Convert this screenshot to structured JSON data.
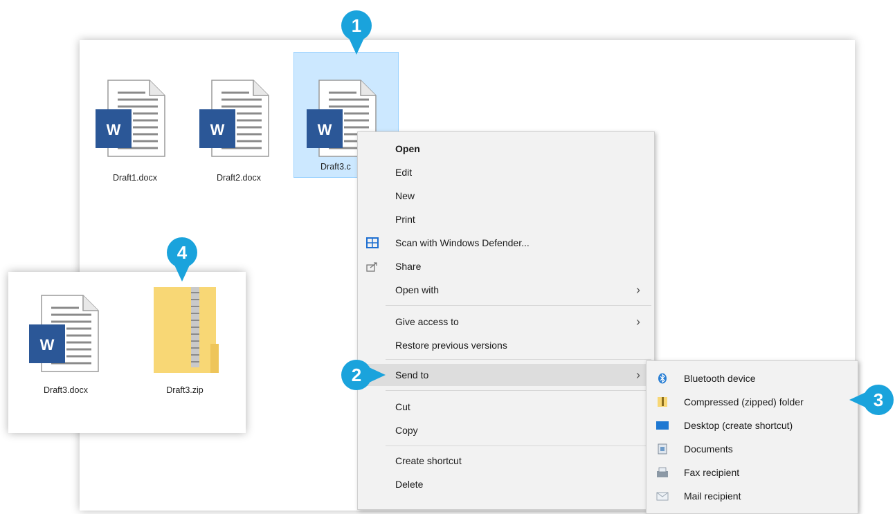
{
  "files": [
    {
      "name": "Draft1.docx"
    },
    {
      "name": "Draft2.docx"
    },
    {
      "name": "Draft3.c"
    }
  ],
  "inset_files": [
    {
      "name": "Draft3.docx"
    },
    {
      "name": "Draft3.zip"
    }
  ],
  "context_menu": {
    "items": [
      {
        "label": "Open"
      },
      {
        "label": "Edit"
      },
      {
        "label": "New"
      },
      {
        "label": "Print"
      },
      {
        "label": "Scan with Windows Defender..."
      },
      {
        "label": "Share"
      },
      {
        "label": "Open with"
      },
      {
        "label": "Give access to"
      },
      {
        "label": "Restore previous versions"
      },
      {
        "label": "Send to"
      },
      {
        "label": "Cut"
      },
      {
        "label": "Copy"
      },
      {
        "label": "Create shortcut"
      },
      {
        "label": "Delete"
      }
    ]
  },
  "send_to_menu": {
    "items": [
      {
        "label": "Bluetooth device"
      },
      {
        "label": "Compressed (zipped) folder"
      },
      {
        "label": "Desktop (create shortcut)"
      },
      {
        "label": "Documents"
      },
      {
        "label": "Fax recipient"
      },
      {
        "label": "Mail recipient"
      }
    ]
  },
  "callouts": [
    "1",
    "2",
    "3",
    "4"
  ],
  "colors": {
    "accent": "#1aa3dc",
    "word_blue": "#2b5797",
    "selection": "#cce8ff",
    "zip_folder": "#f8d775"
  }
}
